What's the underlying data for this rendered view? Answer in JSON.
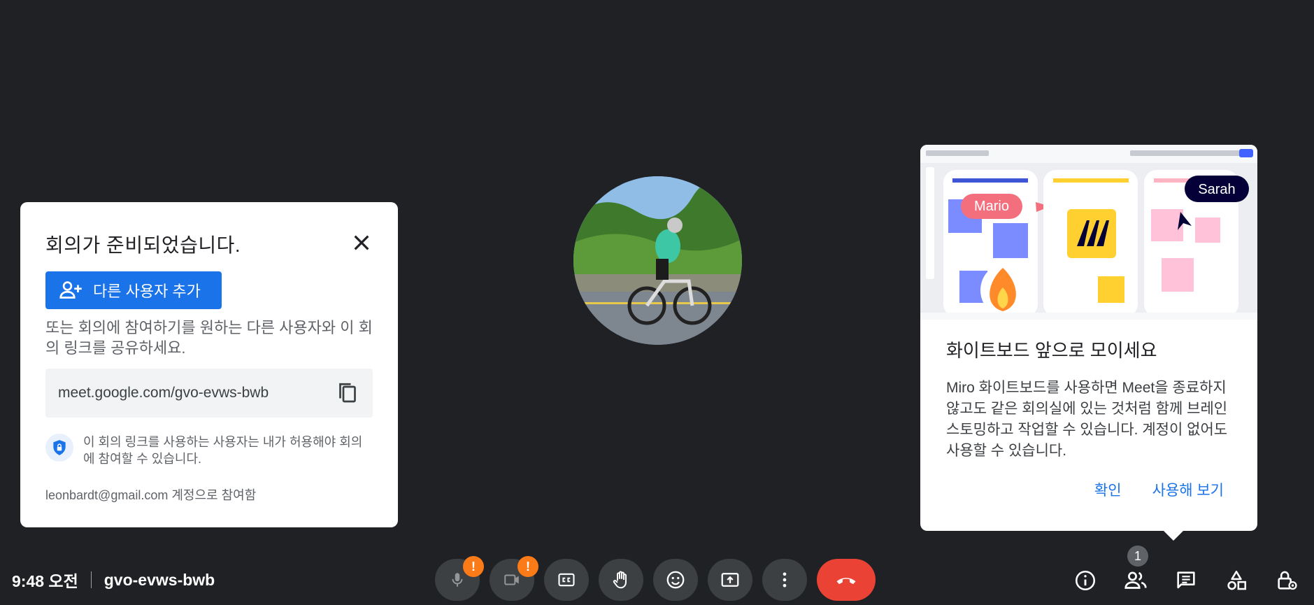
{
  "ready_card": {
    "title": "회의가 준비되었습니다.",
    "add_user_label": "다른 사용자 추가",
    "share_text": "또는 회의에 참여하기를 원하는 다른 사용자와 이 회의 링크를 공유하세요.",
    "meeting_link": "meet.google.com/gvo-evws-bwb",
    "shield_text": "이 회의 링크를 사용하는 사용자는 내가 허용해야 회의에 참여할 수 있습니다.",
    "account_text": "leonbardt@gmail.com 계정으로 참여함"
  },
  "promo_card": {
    "title": "화이트보드 앞으로 모이세요",
    "body": "Miro 화이트보드를 사용하면 Meet을 종료하지 않고도 같은 회의실에 있는 것처럼 함께 브레인스토밍하고 작업할 수 있습니다. 계정이 없어도 사용할 수 있습니다.",
    "confirm_label": "확인",
    "try_label": "사용해 보기",
    "image_labels": {
      "mario": "Mario",
      "sarah": "Sarah"
    }
  },
  "bottom_bar": {
    "time": "9:48 오전",
    "meeting_code": "gvo-evws-bwb",
    "warning_glyph": "!",
    "participants_count": "1"
  },
  "colors": {
    "background": "#202124",
    "primary": "#1a73e8",
    "hangup": "#ea4335",
    "warning": "#fa7b17",
    "control": "#3c4043"
  },
  "icons": [
    "close-icon",
    "add-person-icon",
    "copy-icon",
    "shield-lock-icon",
    "mic-off-icon",
    "camera-off-icon",
    "captions-icon",
    "raise-hand-icon",
    "emoji-icon",
    "present-icon",
    "more-vert-icon",
    "call-end-icon",
    "info-icon",
    "people-icon",
    "chat-icon",
    "activities-icon",
    "host-controls-icon"
  ]
}
